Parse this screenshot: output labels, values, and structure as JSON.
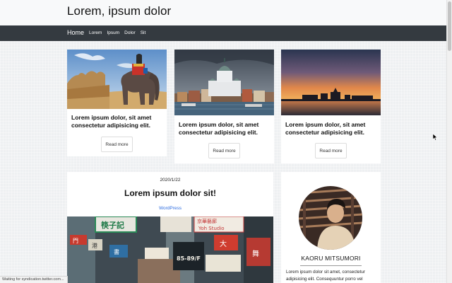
{
  "site": {
    "title": "Lorem, ipsum dolor"
  },
  "nav": {
    "home": "Home",
    "links": [
      "Lorem",
      "Ipsum",
      "Dolor",
      "Sit"
    ]
  },
  "cards": [
    {
      "title": "Lorem ipsum dolor, sit amet consectetur adipisicing elit.",
      "button": "Read more",
      "image": "elephant-at-fort-photo"
    },
    {
      "title": "Lorem ipsum dolor, sit amet consectetur adipisicing elit.",
      "button": "Read more",
      "image": "cathedral-harbor-photo"
    },
    {
      "title": "Lorem ipsum dolor, sit amet consectetur adipisicing elit.",
      "button": "Read more",
      "image": "pier-sunset-photo"
    }
  ],
  "post": {
    "date": "2020/1/22",
    "title": "Lorem ipsum dolor sit!",
    "category": "WordPress",
    "image": "city-street-signs-photo",
    "signs": [
      "筷子記",
      "門",
      "港",
      "書",
      "京華藝廊",
      "Yoh Studio",
      "85-89/F",
      "大",
      "舞"
    ]
  },
  "profile": {
    "name": "KAORU MITSUMORI",
    "bio": "Lorem ipsum dolor sit amet, consectetur adipisicing elit. Consequuntur porro vel",
    "avatar": "person-portrait-photo"
  },
  "status": "Waiting for syndication.twitter.com...",
  "colors": {
    "navbar": "#343a40",
    "header": "#f8f9fa",
    "link": "#2f6ee0"
  }
}
